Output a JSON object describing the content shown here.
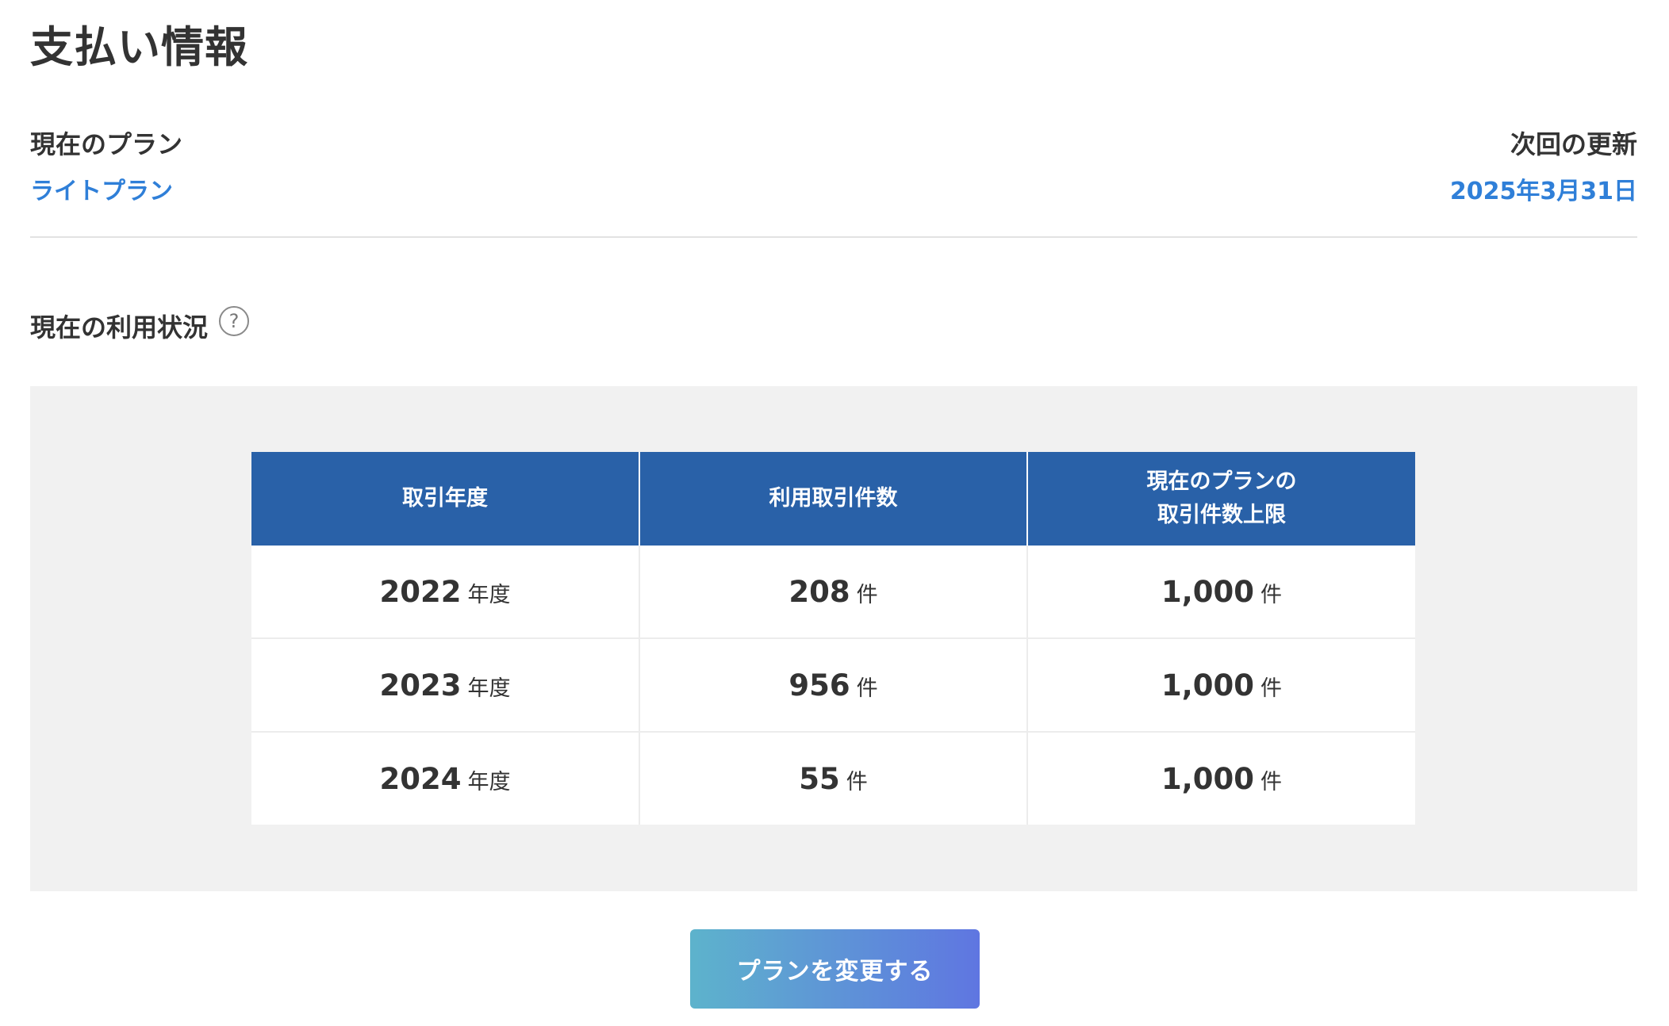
{
  "page": {
    "title": "支払い情報"
  },
  "plan": {
    "current_label": "現在のプラン",
    "current_value": "ライトプラン",
    "renewal_label": "次回の更新",
    "renewal_value": "2025年3月31日"
  },
  "usage": {
    "heading": "現在の利用状況",
    "help_icon": "question-circle-icon",
    "help_glyph": "?",
    "columns": [
      "取引年度",
      "利用取引件数",
      "現在のプランの\n取引件数上限"
    ],
    "rows": [
      {
        "year": "2022",
        "year_unit": "年度",
        "count": "208",
        "count_unit": "件",
        "limit": "1,000",
        "limit_unit": "件"
      },
      {
        "year": "2023",
        "year_unit": "年度",
        "count": "956",
        "count_unit": "件",
        "limit": "1,000",
        "limit_unit": "件"
      },
      {
        "year": "2024",
        "year_unit": "年度",
        "count": "55",
        "count_unit": "件",
        "limit": "1,000",
        "limit_unit": "件"
      }
    ]
  },
  "actions": {
    "change_plan_label": "プランを変更する"
  },
  "colors": {
    "accent_link": "#2f7fd8",
    "table_header": "#2961a8",
    "panel_background": "#f1f1f1",
    "button_gradient_start": "#5db3cc",
    "button_gradient_end": "#5f76e1"
  }
}
